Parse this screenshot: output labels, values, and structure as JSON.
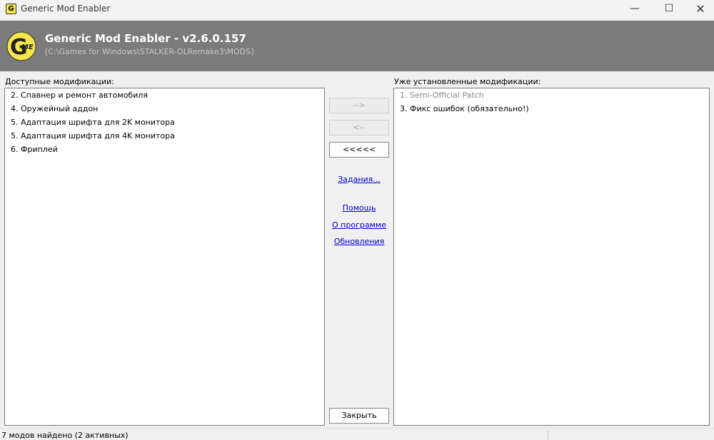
{
  "window": {
    "title": "Generic Mod Enabler",
    "minimize_glyph": "—",
    "maximize_glyph": "☐",
    "close_glyph": "✕",
    "icon_letter": "G"
  },
  "header": {
    "app_name": "Generic Mod Enabler - v2.6.0.157",
    "mods_path": "[C:\\Games for Windows\\STALKER-OLRemake3\\MODS]",
    "logo_letter": "G",
    "logo_sub": "ME",
    "logo_color": "#f5e64a"
  },
  "available": {
    "label": "Доступные модификации:",
    "items": [
      "2. Спавнер и ремонт автомобиля",
      "4. Оружейный аддон",
      "5. Адаптация шрифта для 2K монитора",
      "5. Адаптация шрифта для 4K монитора",
      "6. Фриплей"
    ]
  },
  "installed": {
    "label": "Уже установленные модификации:",
    "items": [
      "1. Semi-Official Patch",
      "3. Фикс ошибок (обязательно!)"
    ]
  },
  "actions": {
    "activate_label": "-->",
    "deactivate_label": "<--",
    "deactivate_all_label": "<<<<<",
    "tasks_link": "Задания...",
    "help_link": "Помощь",
    "about_link": "О программе",
    "updates_link": "Обновления",
    "close_label": "Закрыть"
  },
  "status": {
    "text": "7 модов найдено (2 активных)"
  }
}
